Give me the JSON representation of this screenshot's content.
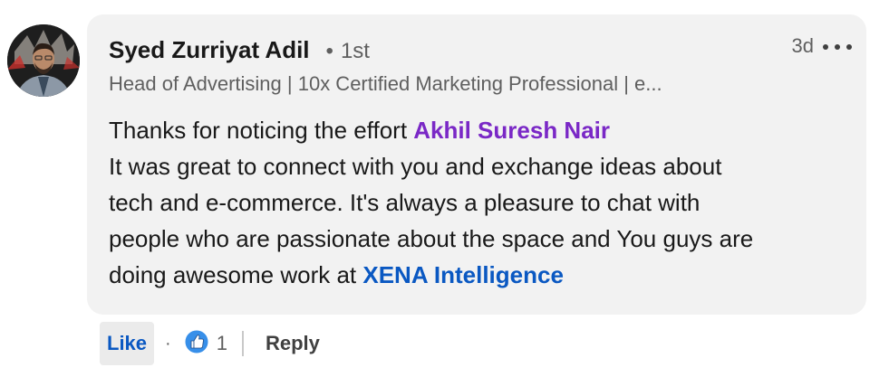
{
  "comment": {
    "author_name": "Syed Zurriyat Adil",
    "connection_degree": "1st",
    "separator_dot": "•",
    "headline": "Head of Advertising | 10x Certified Marketing Professional | e...",
    "time_ago": "3d",
    "more_icon": "more-horizontal-icon",
    "body": {
      "line1_text": "Thanks for noticing the effort ",
      "line1_mention": "Akhil Suresh Nair",
      "line2": "It was great to connect with you and exchange ideas about",
      "line3": "tech and e-commerce. It's always a pleasure to chat with",
      "line4": "people who are passionate about the space and You guys are",
      "line5_text": "doing awesome work at ",
      "line5_mention": "XENA Intelligence"
    }
  },
  "actions": {
    "like_label": "Like",
    "dot": "·",
    "reaction_icon": "thumbs-up-icon",
    "reaction_count": "1",
    "reply_label": "Reply"
  },
  "colors": {
    "person_mention": "#7a28c6",
    "company_mention": "#0a58c2",
    "like_blue": "#0a58c2",
    "bubble_bg": "#f2f2f2"
  }
}
